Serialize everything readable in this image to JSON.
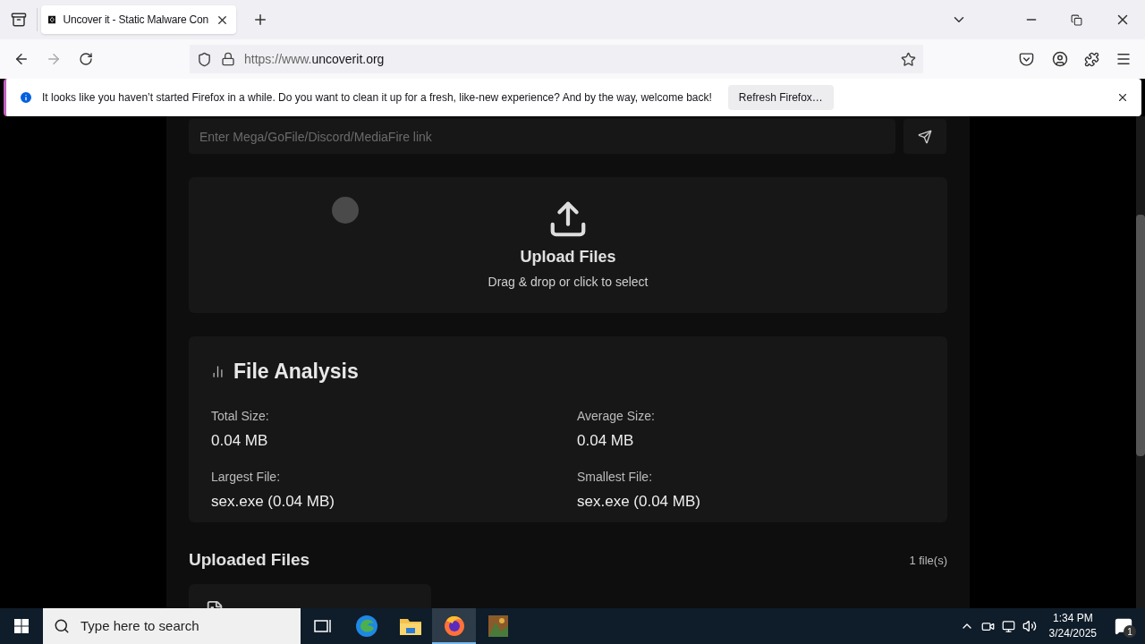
{
  "browser": {
    "tab": {
      "title": "Uncover it - Static Malware Con",
      "selected": true
    },
    "url_prefix": "https://www.",
    "url_domain": "uncoverit.org"
  },
  "notification": {
    "message": "It looks like you haven’t started Firefox in a while. Do you want to clean it up for a fresh, like-new experience? And by the way, welcome back!",
    "button": "Refresh Firefox…"
  },
  "page": {
    "link_input": {
      "placeholder": "Enter Mega/GoFile/Discord/MediaFire link"
    },
    "upload": {
      "title": "Upload Files",
      "subtitle": "Drag & drop or click to select"
    },
    "analysis": {
      "title": "File Analysis",
      "stats": [
        {
          "label": "Total Size:",
          "value": "0.04 MB"
        },
        {
          "label": "Average Size:",
          "value": "0.04 MB"
        },
        {
          "label": "Largest File:",
          "value": "sex.exe (0.04 MB)"
        },
        {
          "label": "Smallest File:",
          "value": "sex.exe (0.04 MB)"
        }
      ]
    },
    "uploaded": {
      "title": "Uploaded Files",
      "count": "1 file(s)"
    }
  },
  "taskbar": {
    "search_placeholder": "Type here to search",
    "apps": [
      {
        "kind": "taskview",
        "selected": false
      },
      {
        "kind": "edge",
        "selected": false
      },
      {
        "kind": "explorer",
        "selected": false
      },
      {
        "kind": "firefox",
        "selected": true
      },
      {
        "kind": "picture",
        "selected": false
      }
    ],
    "time": "1:34 PM",
    "date": "3/24/2025",
    "notifications": "1"
  }
}
